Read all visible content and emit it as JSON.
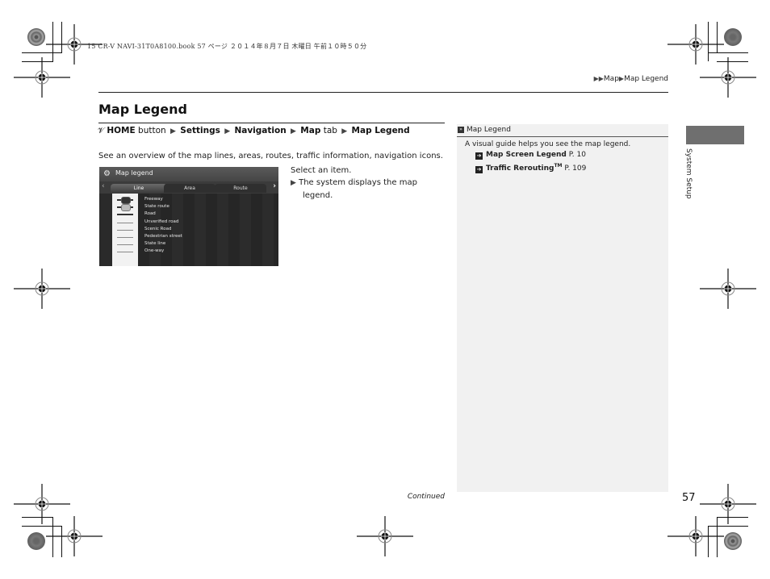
{
  "print_header": {
    "text": "15 CR-V NAVI-31T0A8100.book  57 ページ  ２０１４年８月７日  木曜日  午前１０時５０分"
  },
  "breadcrumb": {
    "items": [
      "Map",
      "Map Legend"
    ]
  },
  "page_title": "Map Legend",
  "nav_path": {
    "icon": "voice-command-icon",
    "steps": [
      {
        "bold": "HOME",
        "normal": " button"
      },
      {
        "bold": "Settings",
        "normal": ""
      },
      {
        "bold": "Navigation",
        "normal": ""
      },
      {
        "bold": "Map",
        "normal": " tab"
      },
      {
        "bold": "Map Legend",
        "normal": ""
      }
    ]
  },
  "intro_text": "See an overview of the map lines, areas, routes, traffic information, navigation icons.",
  "screen": {
    "title": "Map legend",
    "tabs": [
      {
        "label": "Line",
        "active": true
      },
      {
        "label": "Area",
        "active": false
      },
      {
        "label": "Route",
        "active": false
      }
    ],
    "legend_items": [
      {
        "label": "Freeway",
        "symbol": "freeway-badge"
      },
      {
        "label": "State route",
        "symbol": "state-badge"
      },
      {
        "label": "Road",
        "symbol": "thick-line"
      },
      {
        "label": "Unverified road",
        "symbol": "thin-line"
      },
      {
        "label": "Scenic Road",
        "symbol": "thin-line"
      },
      {
        "label": "Pedestrian street",
        "symbol": "thin-line"
      },
      {
        "label": "State line",
        "symbol": "thin-line"
      },
      {
        "label": "One-way",
        "symbol": "arrow-line"
      }
    ]
  },
  "instructions": {
    "step": "Select an item.",
    "result_line1": "The system displays the map",
    "result_line2": "legend."
  },
  "info_panel": {
    "heading": "Map Legend",
    "description": "A visual guide helps you see the map legend.",
    "references": [
      {
        "title": "Map Screen Legend",
        "trademark": "",
        "page": "P. 10"
      },
      {
        "title": "Traffic Rerouting",
        "trademark": "TM",
        "page": "P. 109"
      }
    ]
  },
  "side_section": "System Setup",
  "footer": {
    "continued": "Continued",
    "page_number": "57"
  },
  "colors": {
    "side_tab": "#6f6f6f",
    "panel_bg": "#f1f1f1"
  }
}
